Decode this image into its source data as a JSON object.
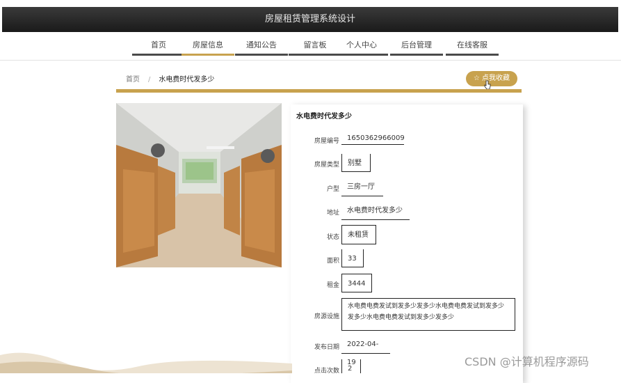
{
  "header": {
    "title": "房屋租赁管理系统设计"
  },
  "nav": {
    "items": [
      {
        "label": "首页"
      },
      {
        "label": "房屋信息"
      },
      {
        "label": "通知公告"
      },
      {
        "label": "留言板"
      },
      {
        "label": "个人中心"
      },
      {
        "label": "后台管理"
      },
      {
        "label": "在线客服"
      }
    ],
    "active_index": 1
  },
  "breadcrumb": {
    "home": "首页",
    "separator": "/",
    "current": "水电费时代发多少"
  },
  "favorite_button": {
    "label": "点我收藏",
    "icon": "star-icon"
  },
  "house": {
    "title": "水电费时代发多少",
    "fields": [
      {
        "label": "房屋编号",
        "value": "1650362966009"
      },
      {
        "label": "房屋类型",
        "value": "别墅"
      },
      {
        "label": "户型",
        "value": "三房一厅"
      },
      {
        "label": "地址",
        "value": "水电费时代发多少"
      },
      {
        "label": "状态",
        "value": "未租赁"
      },
      {
        "label": "面积",
        "value": "33"
      },
      {
        "label": "租金",
        "value": "3444"
      },
      {
        "label": "房源设施",
        "value": "水电费电费发试到发多少发多少水电费电费发试到发多少发多少水电费电费发试到发多少发多少"
      },
      {
        "label": "发布日期",
        "value": "2022-04-19"
      },
      {
        "label": "点击次数",
        "value": "2"
      }
    ]
  },
  "watermark": "CSDN @计算机程序源码",
  "colors": {
    "accent": "#c8a24e",
    "header_bg": "#222222"
  }
}
